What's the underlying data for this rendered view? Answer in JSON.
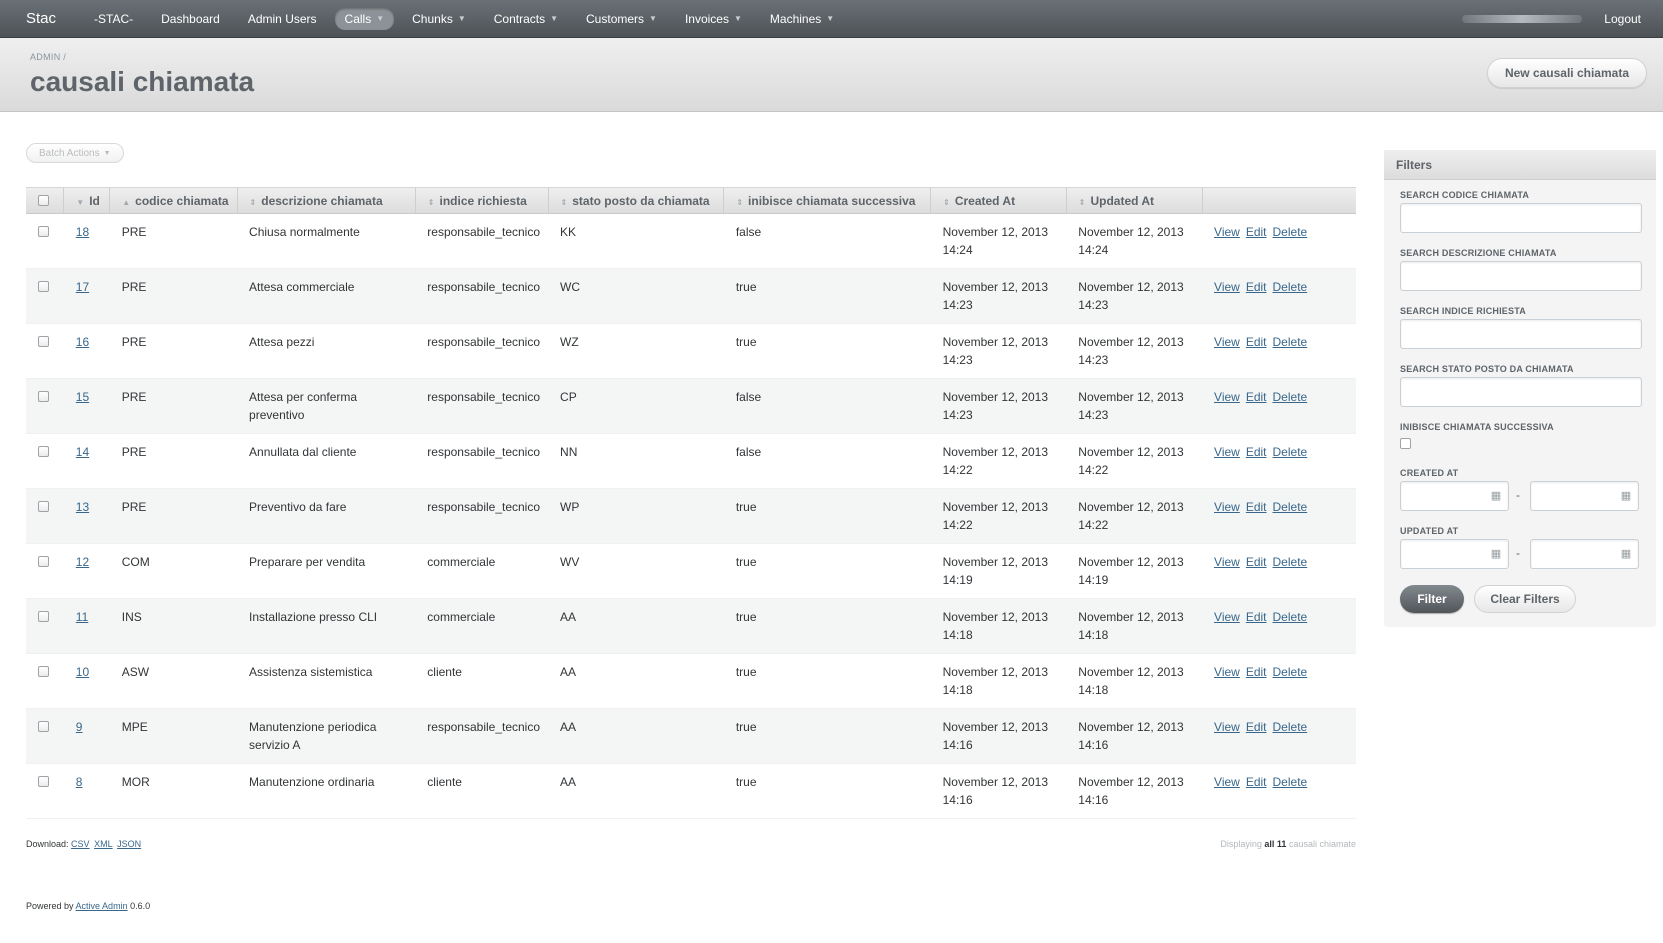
{
  "header": {
    "site_title": "Stac",
    "tabs": [
      {
        "label": "-STAC-",
        "dropdown": false,
        "current": false
      },
      {
        "label": "Dashboard",
        "dropdown": false,
        "current": false
      },
      {
        "label": "Admin Users",
        "dropdown": false,
        "current": false
      },
      {
        "label": "Calls",
        "dropdown": true,
        "current": true
      },
      {
        "label": "Chunks",
        "dropdown": true,
        "current": false
      },
      {
        "label": "Contracts",
        "dropdown": true,
        "current": false
      },
      {
        "label": "Customers",
        "dropdown": true,
        "current": false
      },
      {
        "label": "Invoices",
        "dropdown": true,
        "current": false
      },
      {
        "label": "Machines",
        "dropdown": true,
        "current": false
      }
    ],
    "logout_label": "Logout"
  },
  "title_bar": {
    "breadcrumb": "ADMIN /",
    "title": "causali chiamata",
    "new_button": "New causali chiamata"
  },
  "batch_actions_label": "Batch Actions",
  "table": {
    "columns": [
      {
        "label": "Id",
        "sort_icon": "▼"
      },
      {
        "label": "codice chiamata",
        "sort_icon": "▲"
      },
      {
        "label": "descrizione chiamata",
        "sort_icon": "⇕"
      },
      {
        "label": "indice richiesta",
        "sort_icon": "⇕"
      },
      {
        "label": "stato posto da chiamata",
        "sort_icon": "⇕"
      },
      {
        "label": "inibisce chiamata successiva",
        "sort_icon": "⇕"
      },
      {
        "label": "Created At",
        "sort_icon": "⇕"
      },
      {
        "label": "Updated At",
        "sort_icon": "⇕"
      }
    ],
    "action_labels": {
      "view": "View",
      "edit": "Edit",
      "delete": "Delete"
    },
    "rows": [
      {
        "id": "18",
        "codice": "PRE",
        "descrizione": "Chiusa normalmente",
        "indice": "responsabile_tecnico",
        "stato": "KK",
        "inibisce": "false",
        "created": "November 12, 2013 14:24",
        "updated": "November 12, 2013 14:24"
      },
      {
        "id": "17",
        "codice": "PRE",
        "descrizione": "Attesa commerciale",
        "indice": "responsabile_tecnico",
        "stato": "WC",
        "inibisce": "true",
        "created": "November 12, 2013 14:23",
        "updated": "November 12, 2013 14:23"
      },
      {
        "id": "16",
        "codice": "PRE",
        "descrizione": "Attesa pezzi",
        "indice": "responsabile_tecnico",
        "stato": "WZ",
        "inibisce": "true",
        "created": "November 12, 2013 14:23",
        "updated": "November 12, 2013 14:23"
      },
      {
        "id": "15",
        "codice": "PRE",
        "descrizione": "Attesa per conferma preventivo",
        "indice": "responsabile_tecnico",
        "stato": "CP",
        "inibisce": "false",
        "created": "November 12, 2013 14:23",
        "updated": "November 12, 2013 14:23"
      },
      {
        "id": "14",
        "codice": "PRE",
        "descrizione": "Annullata dal cliente",
        "indice": "responsabile_tecnico",
        "stato": "NN",
        "inibisce": "false",
        "created": "November 12, 2013 14:22",
        "updated": "November 12, 2013 14:22"
      },
      {
        "id": "13",
        "codice": "PRE",
        "descrizione": "Preventivo da fare",
        "indice": "responsabile_tecnico",
        "stato": "WP",
        "inibisce": "true",
        "created": "November 12, 2013 14:22",
        "updated": "November 12, 2013 14:22"
      },
      {
        "id": "12",
        "codice": "COM",
        "descrizione": "Preparare per vendita",
        "indice": "commerciale",
        "stato": "WV",
        "inibisce": "true",
        "created": "November 12, 2013 14:19",
        "updated": "November 12, 2013 14:19"
      },
      {
        "id": "11",
        "codice": "INS",
        "descrizione": "Installazione presso CLI",
        "indice": "commerciale",
        "stato": "AA",
        "inibisce": "true",
        "created": "November 12, 2013 14:18",
        "updated": "November 12, 2013 14:18"
      },
      {
        "id": "10",
        "codice": "ASW",
        "descrizione": "Assistenza sistemistica",
        "indice": "cliente",
        "stato": "AA",
        "inibisce": "true",
        "created": "November 12, 2013 14:18",
        "updated": "November 12, 2013 14:18"
      },
      {
        "id": "9",
        "codice": "MPE",
        "descrizione": "Manutenzione periodica servizio A",
        "indice": "responsabile_tecnico",
        "stato": "AA",
        "inibisce": "true",
        "created": "November 12, 2013 14:16",
        "updated": "November 12, 2013 14:16"
      },
      {
        "id": "8",
        "codice": "MOR",
        "descrizione": "Manutenzione ordinaria",
        "indice": "cliente",
        "stato": "AA",
        "inibisce": "true",
        "created": "November 12, 2013 14:16",
        "updated": "November 12, 2013 14:16"
      }
    ]
  },
  "download": {
    "label": "Download:",
    "formats": [
      "CSV",
      "XML",
      "JSON"
    ]
  },
  "pagination": {
    "prefix": "Displaying",
    "bold": "all 11",
    "suffix": "causali chiamate"
  },
  "footer": {
    "prefix": "Powered by",
    "link": "Active Admin",
    "version": "0.6.0"
  },
  "sidebar": {
    "title": "Filters",
    "labels": {
      "codice": "SEARCH CODICE CHIAMATA",
      "descrizione": "SEARCH DESCRIZIONE CHIAMATA",
      "indice": "SEARCH INDICE RICHIESTA",
      "stato": "SEARCH STATO POSTO DA CHIAMATA",
      "inibisce": "INIBISCE CHIAMATA SUCCESSIVA",
      "created": "CREATED AT",
      "updated": "UPDATED AT"
    },
    "range_separator": "-",
    "filter_button": "Filter",
    "clear_button": "Clear Filters"
  },
  "icons": {
    "dropdown": "chevron-down-icon",
    "calendar": "calendar-icon",
    "sort_desc": "sort-down-icon",
    "sort_asc": "sort-up-icon",
    "sortable": "sortable-icon"
  },
  "colors": {
    "header_bg": "#5a6064",
    "link": "#38678b",
    "title": "#5e6469"
  }
}
